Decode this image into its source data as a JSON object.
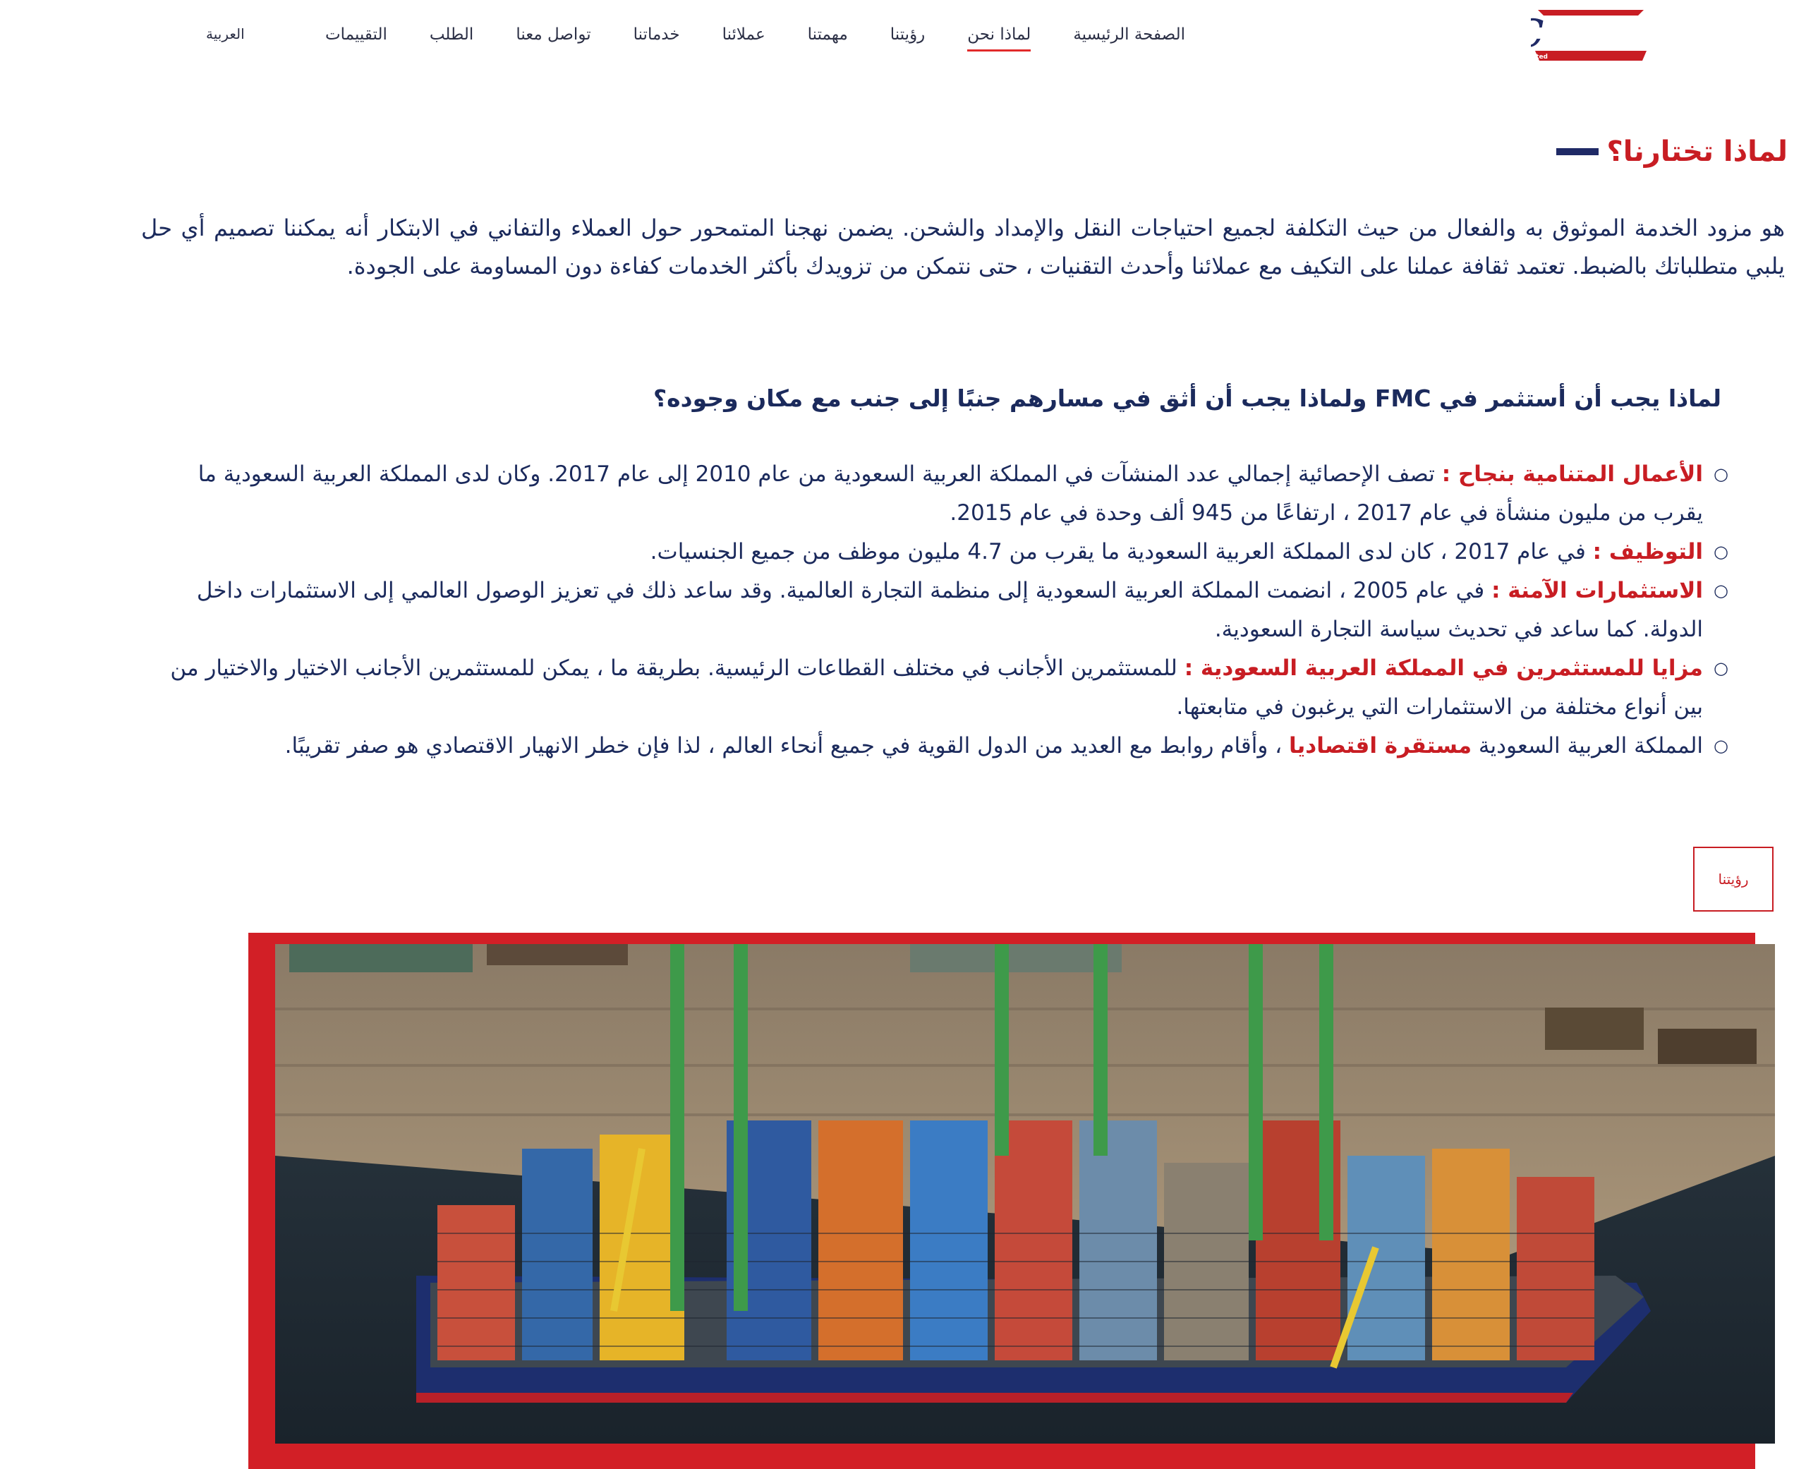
{
  "header": {
    "logo_text": "FMC",
    "logo_tagline": "Globally Connected Locally Invested",
    "nav": [
      {
        "label": "الصفحة الرئيسية"
      },
      {
        "label": "لماذا نحن",
        "active": true
      },
      {
        "label": "رؤيتنا"
      },
      {
        "label": "مهمتنا"
      },
      {
        "label": "عملائنا"
      },
      {
        "label": "خدماتنا"
      },
      {
        "label": "تواصل معنا"
      },
      {
        "label": "الطلب"
      },
      {
        "label": "التقييمات"
      }
    ],
    "language": "العربية"
  },
  "why_us": {
    "title": "لماذا تختارنا؟",
    "intro": "هو مزود الخدمة الموثوق به والفعال من حيث التكلفة لجميع احتياجات النقل والإمداد والشحن. يضمن نهجنا المتمحور حول العملاء والتفاني في الابتكار أنه يمكننا تصميم أي حل يلبي متطلباتك بالضبط. تعتمد ثقافة عملنا على التكيف مع عملائنا وأحدث التقنيات ، حتى نتمكن من تزويدك بأكثر الخدمات كفاءة دون المساومة على الجودة.",
    "subheading": "لماذا يجب أن أستثمر في FMC ولماذا يجب أن أثق في مسارهم جنبًا إلى جنب مع مكان وجوده؟",
    "points": [
      {
        "highlight": "الأعمال المتنامية بنجاح :",
        "text": " تصف الإحصائية إجمالي عدد المنشآت في المملكة العربية السعودية من عام 2010 إلى عام 2017. وكان لدى المملكة العربية السعودية ما يقرب من مليون منشأة في عام 2017 ، ارتفاعًا من 945 ألف وحدة في عام 2015."
      },
      {
        "highlight": "التوظيف :",
        "text": " في عام 2017 ، كان لدى المملكة العربية السعودية ما يقرب من 4.7 مليون موظف من جميع الجنسيات."
      },
      {
        "highlight": "الاستثمارات الآمنة :",
        "text": " في عام 2005 ، انضمت المملكة العربية السعودية إلى منظمة التجارة العالمية. وقد ساعد ذلك في تعزيز الوصول العالمي إلى الاستثمارات داخل الدولة. كما ساعد في تحديث سياسة التجارة السعودية."
      },
      {
        "highlight": "مزايا للمستثمرين في المملكة العربية السعودية :",
        "text": " للمستثمرين الأجانب في مختلف القطاعات الرئيسية. بطريقة ما ، يمكن للمستثمرين الأجانب الاختيار والاختيار من بين أنواع مختلفة من الاستثمارات التي يرغبون في متابعتها."
      },
      {
        "prefix": "المملكة العربية السعودية ",
        "highlight": "مستقرة اقتصاديا",
        "text": " ، وأقام روابط مع العديد من الدول القوية في جميع أنحاء العالم ، لذا فإن خطر الانهيار الاقتصادي هو صفر تقريبًا."
      }
    ]
  },
  "vision_button": "رؤيتنا",
  "colors": {
    "brand_red": "#c81d23",
    "brand_navy": "#1f2a66",
    "text": "#1b2a5c"
  }
}
